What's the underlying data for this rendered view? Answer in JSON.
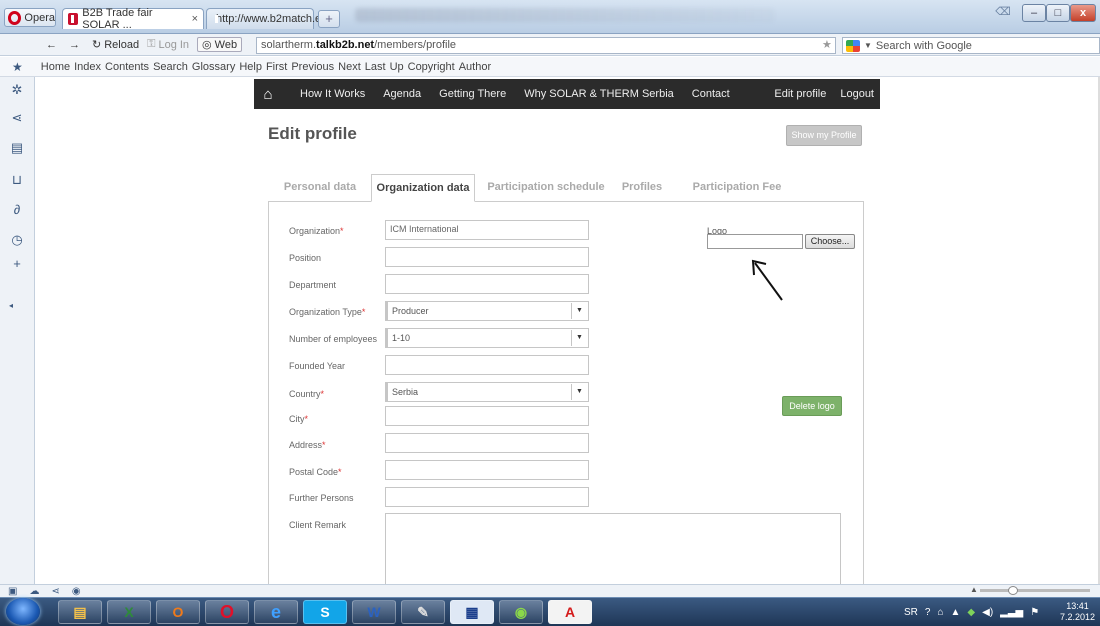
{
  "browser": {
    "opera_label": "Opera",
    "tabs": [
      {
        "label": "B2B Trade fair SOLAR ...",
        "close": "×"
      },
      {
        "label": "http://www.b2match.e...",
        "close": "×"
      }
    ],
    "new_tab": "+",
    "window_controls": {
      "minimize": "–",
      "maximize": "□",
      "close": "x"
    },
    "nav": {
      "back": "←",
      "forward": "→",
      "reload": "Reload",
      "login": "Log In",
      "web": "Web"
    },
    "address": {
      "prefix": "solartherm.",
      "domain": "talkb2b.net",
      "path": "/members/profile"
    },
    "search_placeholder": "Search with Google",
    "bookmarks": [
      "Home",
      "Index",
      "Contents",
      "Search",
      "Glossary",
      "Help",
      "First",
      "Previous",
      "Next",
      "Last",
      "Up",
      "Copyright",
      "Author"
    ]
  },
  "site": {
    "home_icon": "home-icon",
    "nav_links": [
      "How It Works",
      "Agenda",
      "Getting There",
      "Why SOLAR & THERM Serbia",
      "Contact"
    ],
    "nav_right": [
      "Edit profile",
      "Logout"
    ],
    "page_title": "Edit profile",
    "show_profile_label": "Show my Profile",
    "tabs": [
      "Personal data",
      "Organization data",
      "Participation schedule",
      "Profiles",
      "Participation Fee"
    ],
    "active_tab": "Organization data",
    "fields": [
      {
        "label": "Organization",
        "required": true,
        "value": "ICM International",
        "type": "text"
      },
      {
        "label": "Position",
        "required": false,
        "value": "",
        "type": "text"
      },
      {
        "label": "Department",
        "required": false,
        "value": "",
        "type": "text"
      },
      {
        "label": "Organization Type",
        "required": true,
        "value": "Producer",
        "type": "select"
      },
      {
        "label": "Number of employees",
        "required": false,
        "value": "1-10",
        "type": "select"
      },
      {
        "label": "Founded Year",
        "required": false,
        "value": "",
        "type": "text"
      },
      {
        "label": "Country",
        "required": true,
        "value": "Serbia",
        "type": "select"
      },
      {
        "label": "City",
        "required": true,
        "value": "",
        "type": "text"
      },
      {
        "label": "Address",
        "required": true,
        "value": "",
        "type": "text"
      },
      {
        "label": "Postal Code",
        "required": true,
        "value": "",
        "type": "text"
      },
      {
        "label": "Further Persons",
        "required": false,
        "value": "",
        "type": "text"
      },
      {
        "label": "Client Remark",
        "required": false,
        "value": "",
        "type": "textarea"
      }
    ],
    "required_marker": "*",
    "logo_label": "Logo",
    "choose_label": "Choose...",
    "delete_logo_label": "Delete logo",
    "select_arrow": "▼"
  },
  "taskbar": {
    "tray_lang": "SR",
    "clock_time": "13:41",
    "clock_date": "7.2.2012"
  },
  "colors": {
    "delete_green": "#7db26a",
    "nav_dark": "#2b2b2b",
    "required_red": "#dd3333"
  }
}
